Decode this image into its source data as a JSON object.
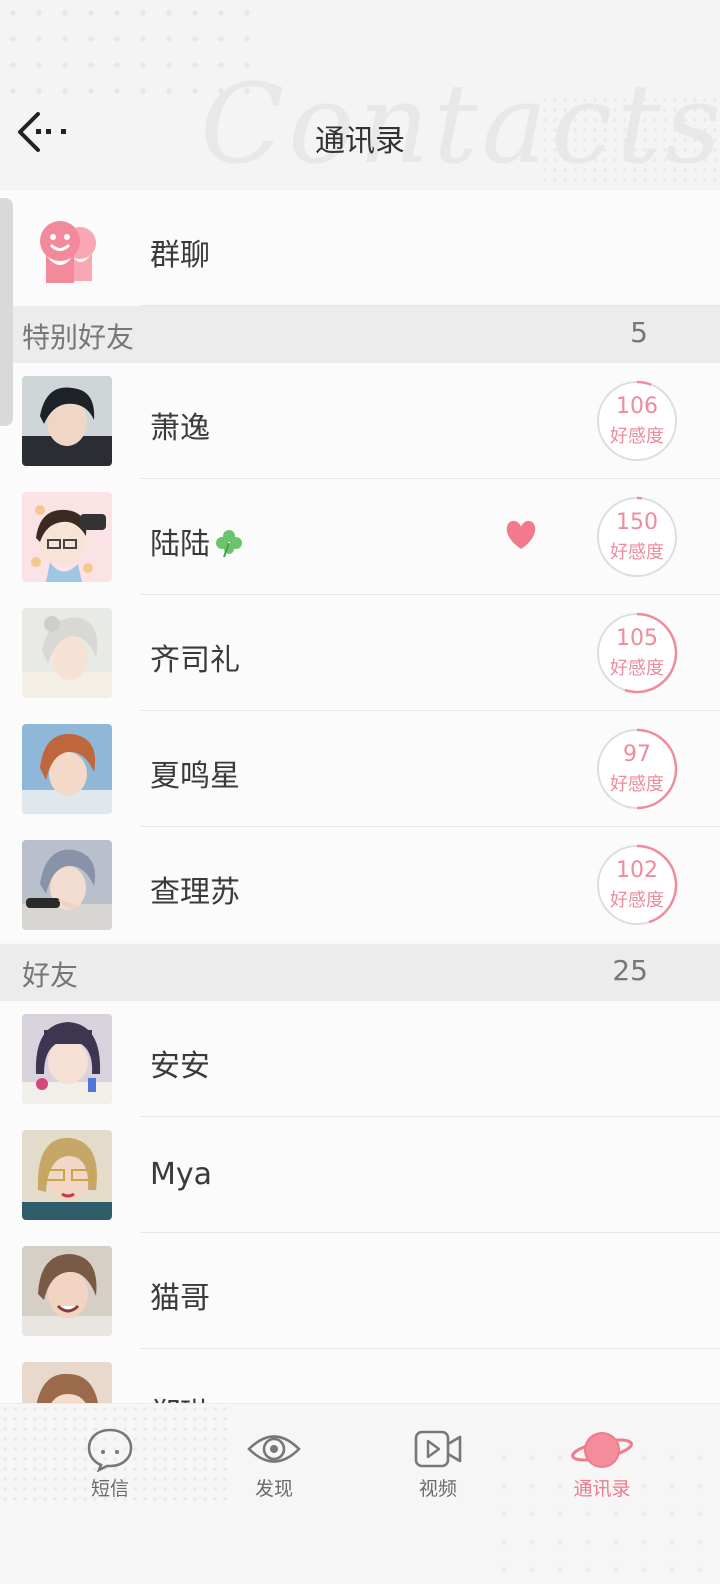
{
  "header": {
    "title": "通讯录",
    "watermark": "Contacts"
  },
  "group_chat": {
    "label": "群聊"
  },
  "sections": [
    {
      "title": "特别好友",
      "count": "5"
    },
    {
      "title": "好友",
      "count": "25"
    }
  ],
  "special_friends": [
    {
      "name": "萧逸",
      "affinity_value": "106",
      "affinity_label": "好感度",
      "affinity_fraction": 0.06
    },
    {
      "name": "陆陆",
      "affinity_value": "150",
      "affinity_label": "好感度",
      "affinity_fraction": 0.02
    },
    {
      "name": "齐司礼",
      "affinity_value": "105",
      "affinity_label": "好感度",
      "affinity_fraction": 0.55
    },
    {
      "name": "夏鸣星",
      "affinity_value": "97",
      "affinity_label": "好感度",
      "affinity_fraction": 0.5
    },
    {
      "name": "查理苏",
      "affinity_value": "102",
      "affinity_label": "好感度",
      "affinity_fraction": 0.45
    }
  ],
  "friends": [
    {
      "name": "安安"
    },
    {
      "name": "Mya"
    },
    {
      "name": "猫哥"
    },
    {
      "name": "郑琳"
    }
  ],
  "bottom_nav": [
    {
      "label": "短信",
      "icon": "chat-bubble-icon"
    },
    {
      "label": "发现",
      "icon": "eye-icon"
    },
    {
      "label": "视频",
      "icon": "video-icon"
    },
    {
      "label": "通讯录",
      "icon": "planet-icon",
      "active": true
    }
  ],
  "colors": {
    "accent": "#f07b8c",
    "pink": "#f08a9d",
    "section_bg": "#ececec"
  }
}
